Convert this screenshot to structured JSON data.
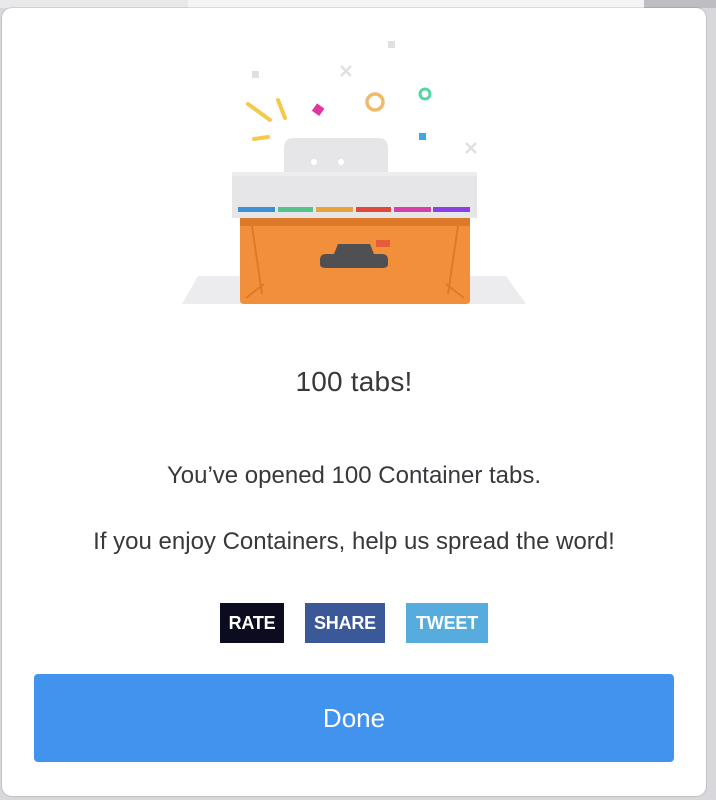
{
  "dialog": {
    "title": "100 tabs!",
    "message_line1": "You’ve opened 100 Container tabs.",
    "message_line2": "If you enjoy Containers, help us spread the word!",
    "buttons": {
      "rate": "RATE",
      "share": "SHARE",
      "tweet": "TWEET",
      "done": "Done"
    },
    "colors": {
      "rate": "#0c0c21",
      "share": "#3b5998",
      "tweet": "#55acdd",
      "done": "#4193ee",
      "box": "#f28f3b",
      "tab_stripes": [
        "#3d8fd6",
        "#55c18c",
        "#e8a33a",
        "#e0493a",
        "#d63fa8",
        "#8d3fe6"
      ]
    },
    "illustration": "containers-box-confetti"
  }
}
